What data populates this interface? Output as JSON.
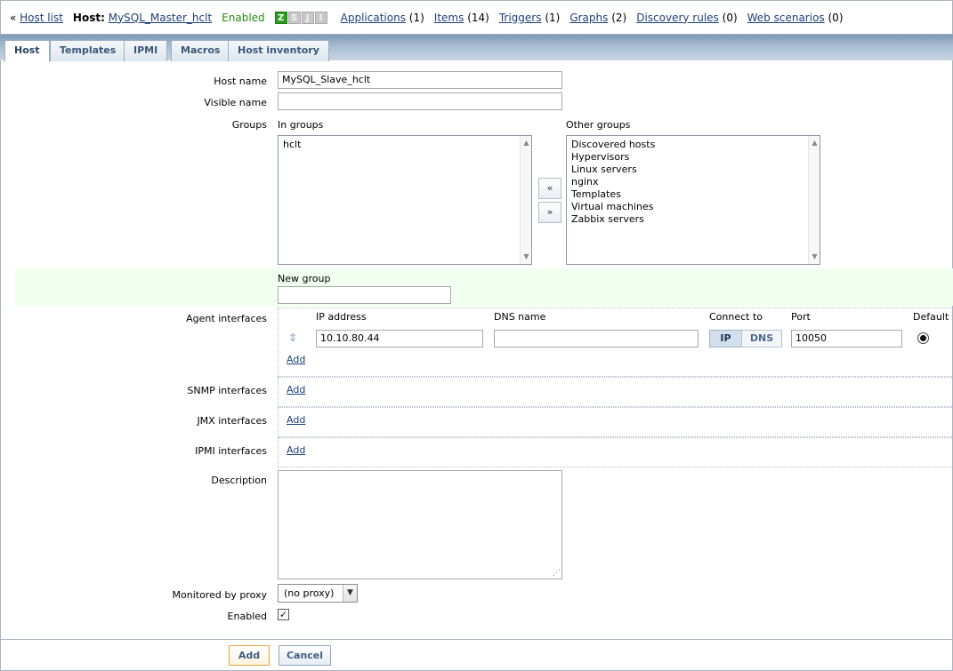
{
  "header": {
    "host_list": "Host list",
    "host_label": "Host:",
    "host_name": "MySQL_Master_hclt",
    "status": "Enabled",
    "status_icons": [
      "Z",
      "S",
      "J",
      "I"
    ],
    "applications_label": "Applications",
    "applications_count": "(1)",
    "items_label": "Items",
    "items_count": "(14)",
    "triggers_label": "Triggers",
    "triggers_count": "(1)",
    "graphs_label": "Graphs",
    "graphs_count": "(2)",
    "discovery_label": "Discovery rules",
    "discovery_count": "(0)",
    "web_label": "Web scenarios",
    "web_count": "(0)"
  },
  "tabs": [
    "Host",
    "Templates",
    "IPMI",
    "Macros",
    "Host inventory"
  ],
  "form": {
    "host_name_label": "Host name",
    "host_name_value": "MySQL_Slave_hclt",
    "visible_name_label": "Visible name",
    "visible_name_value": "",
    "groups_label": "Groups",
    "in_groups_label": "In groups",
    "in_groups": [
      "hclt"
    ],
    "other_groups_label": "Other groups",
    "other_groups": [
      "Discovered hosts",
      "Hypervisors",
      "Linux servers",
      "nginx",
      "Templates",
      "Virtual machines",
      "Zabbix servers"
    ],
    "move_left": "«",
    "move_right": "»",
    "new_group_label": "New group",
    "new_group_value": "",
    "agent_interfaces_label": "Agent interfaces",
    "ip_address_label": "IP address",
    "dns_name_label": "DNS name",
    "connect_to_label": "Connect to",
    "port_label": "Port",
    "default_label": "Default",
    "agent_ip": "10.10.80.44",
    "agent_dns": "",
    "connect_ip": "IP",
    "connect_dns": "DNS",
    "agent_port": "10050",
    "add_link": "Add",
    "snmp_label": "SNMP interfaces",
    "jmx_label": "JMX interfaces",
    "ipmi_label": "IPMI interfaces",
    "description_label": "Description",
    "description_value": "",
    "proxy_label": "Monitored by proxy",
    "proxy_value": "(no proxy)",
    "enabled_label": "Enabled",
    "enabled_mark": "✓"
  },
  "footer": {
    "add_button": "Add",
    "cancel_button": "Cancel"
  },
  "colors": {
    "link": "#1f3f7a",
    "enabled": "#2a8a12",
    "new_group_bg": "#f1fff1"
  }
}
